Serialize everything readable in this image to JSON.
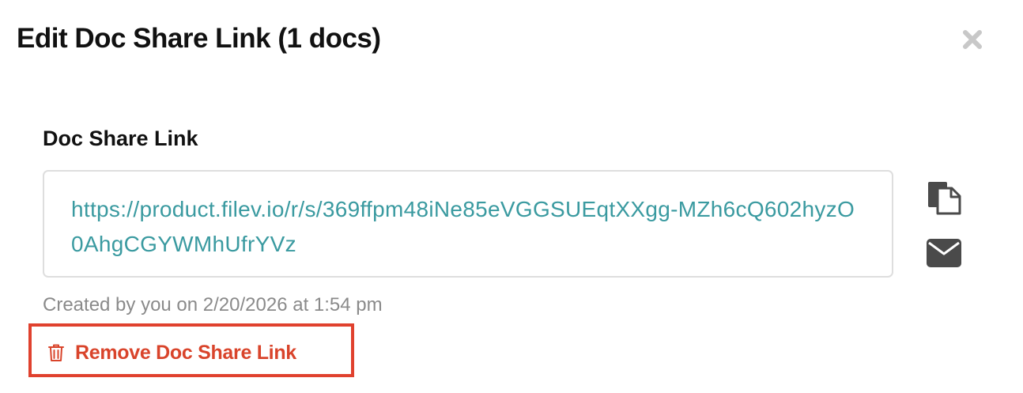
{
  "dialog": {
    "title": "Edit Doc Share Link (1 docs)",
    "close_icon": "close-icon"
  },
  "share": {
    "label": "Doc Share Link",
    "url": "https://product.filev.io/r/s/369ffpm48iNe85eVGGSUEqtXXgg-MZh6cQ602hyzO0AhgCGYWMhUfrYVz",
    "copy_icon": "copy-icon",
    "email_icon": "envelope-icon",
    "meta": "Created by you on 2/20/2026 at 1:54 pm"
  },
  "remove": {
    "label": "Remove Doc Share Link",
    "icon": "trash-icon"
  },
  "colors": {
    "link": "#3a9aa0",
    "danger": "#d9442b",
    "highlight_border": "#e0412e",
    "muted": "#8a8a8a",
    "icon": "#4a4a4a"
  }
}
